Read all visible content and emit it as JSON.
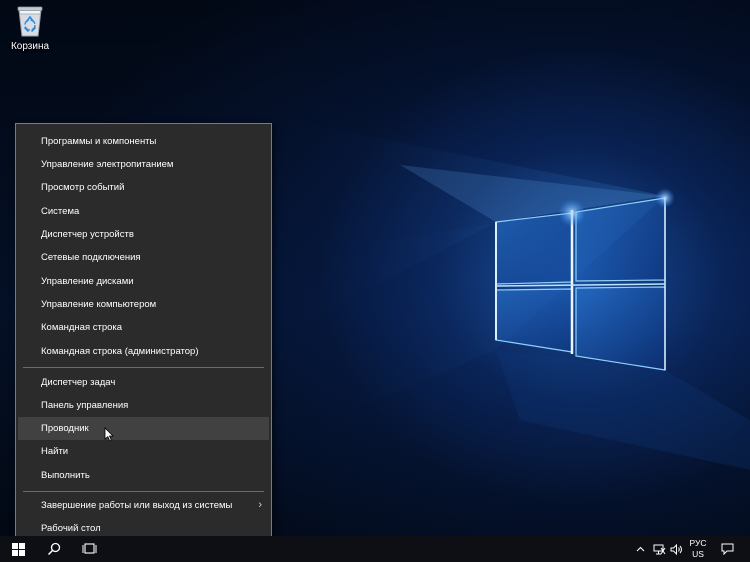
{
  "desktop": {
    "recycle_bin_label": "Корзина"
  },
  "menu": {
    "group1": [
      "Программы и компоненты",
      "Управление электропитанием",
      "Просмотр событий",
      "Система",
      "Диспетчер устройств",
      "Сетевые подключения",
      "Управление дисками",
      "Управление компьютером",
      "Командная строка",
      "Командная строка (администратор)"
    ],
    "group2": [
      "Диспетчер задач",
      "Панель управления",
      "Проводник",
      "Найти",
      "Выполнить"
    ],
    "group3": [
      "Завершение работы или выход из системы",
      "Рабочий стол"
    ],
    "highlighted_item": "Проводник",
    "submenu_arrow": "›"
  },
  "taskbar": {
    "language": "РУС",
    "layout": "US",
    "tray_chevron": "^"
  },
  "colors": {
    "menu_bg": "#2b2b2b",
    "menu_highlight": "#414141",
    "taskbar_bg": "#0d0f14",
    "accent": "#3a9bff"
  }
}
